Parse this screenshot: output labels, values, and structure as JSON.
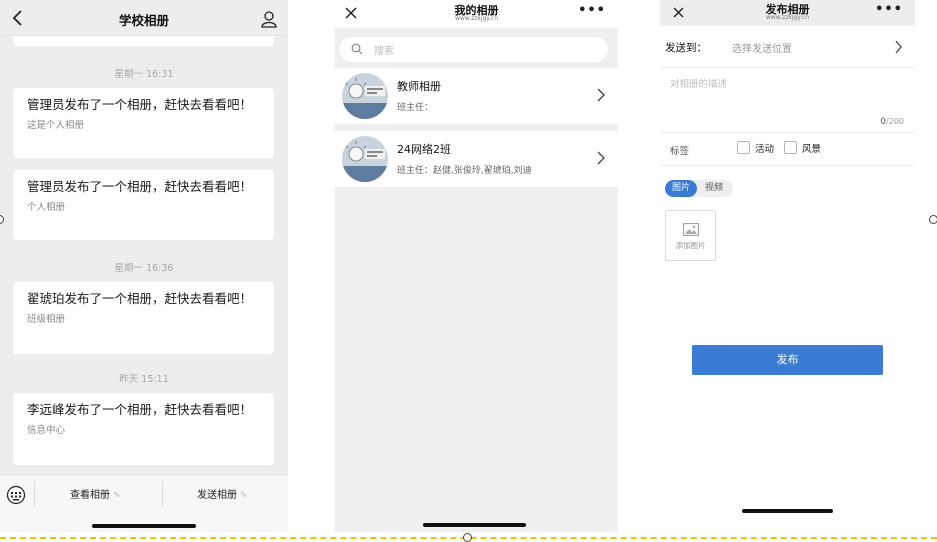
{
  "screen1": {
    "title": "学校相册",
    "messages": [
      {
        "time": "星期一 16:31",
        "title": "管理员发布了一个相册，赶快去看看吧！",
        "sub": "这是个人相册"
      },
      {
        "title": "管理员发布了一个相册，赶快去看看吧！",
        "sub": "个人相册"
      },
      {
        "time": "星期一 16:36",
        "title": "翟琥珀发布了一个相册，赶快去看看吧！",
        "sub": "班级相册"
      },
      {
        "time": "昨天 15:11",
        "title": "李远峰发布了一个相册，赶快去看看吧！",
        "sub": "信息中心"
      }
    ],
    "bottom": {
      "view_label": "查看相册",
      "send_label": "发送相册"
    }
  },
  "screen2": {
    "title": "我的相册",
    "domain": "www.zzkjgy.cn",
    "search_placeholder": "搜索",
    "albums": [
      {
        "name": "教师相册",
        "teacher": "班主任："
      },
      {
        "name": "24网络2班",
        "teacher": "班主任：赵健,张俊玲,翟琥珀,刘迪"
      }
    ]
  },
  "screen3": {
    "title": "发布相册",
    "domain": "www.zzkjgy.cn",
    "send_to_label": "发送到：",
    "send_to_placeholder": "选择发送位置",
    "desc_placeholder": "对相册的描述",
    "count_current": "0",
    "count_max": "/200",
    "tag_label": "标签",
    "tags": [
      "活动",
      "风景"
    ],
    "media_tabs": [
      "图片",
      "视频"
    ],
    "add_image_label": "添加图片",
    "publish_label": "发布"
  },
  "colors": {
    "accent": "#3a7bd5",
    "page_bg": "#ededed",
    "guide_dash": "#f2c200"
  }
}
